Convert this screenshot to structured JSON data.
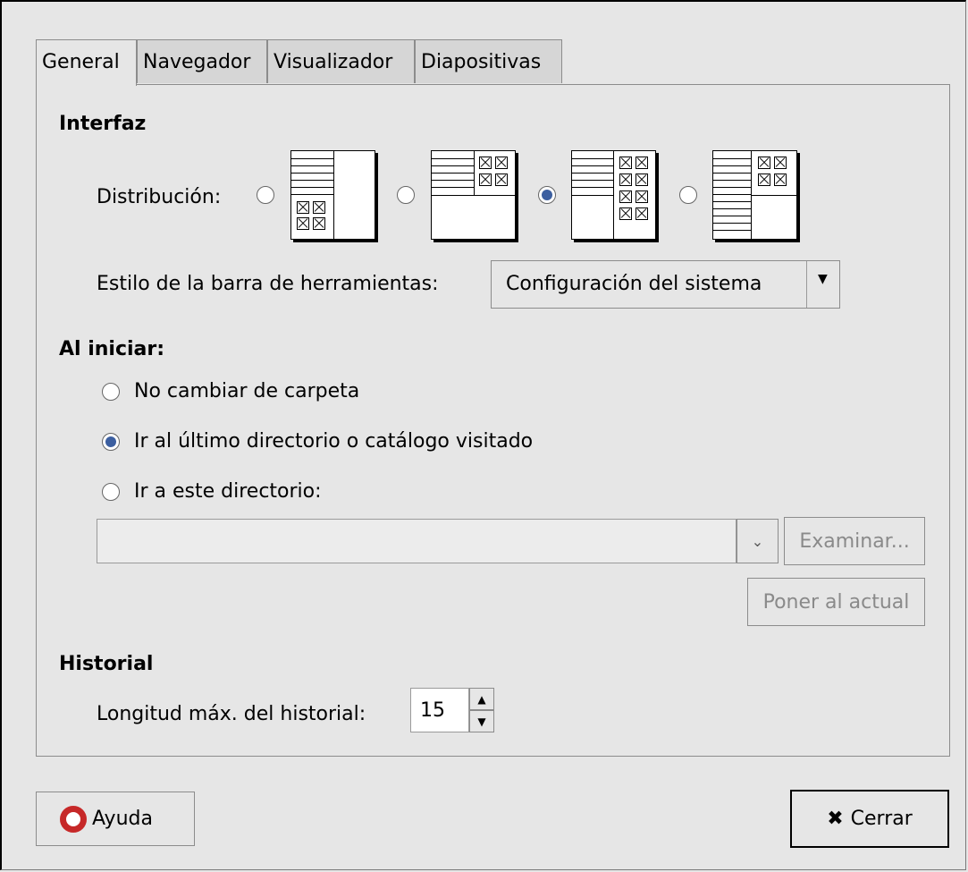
{
  "tabs": [
    "General",
    "Navegador",
    "Visualizador",
    "Diapositivas"
  ],
  "active_tab": "General",
  "interfaz": {
    "heading": "Interfaz",
    "distribucion_label": "Distribución:",
    "selected_layout_index": 2,
    "toolbar_label": "Estilo de la barra de herramientas:",
    "toolbar_value": "Configuración del sistema"
  },
  "startup": {
    "heading": "Al iniciar:",
    "options": [
      "No cambiar de carpeta",
      "Ir al último directorio o catálogo visitado",
      "Ir a este directorio:"
    ],
    "selected_index": 1,
    "directory_value": "",
    "browse_button": "Examinar...",
    "set_current_button": "Poner al actual"
  },
  "historial": {
    "heading": "Historial",
    "length_label": "Longitud máx. del historial:",
    "length_value": "15"
  },
  "footer": {
    "help_button": "Ayuda",
    "close_button": "Cerrar"
  },
  "colors": {
    "background": "#e6e6e6",
    "radio_selected": "#3c5fa0"
  },
  "icons": [
    "help-icon",
    "close-icon",
    "chevron-down-icon",
    "spin-up-icon",
    "spin-down-icon"
  ]
}
